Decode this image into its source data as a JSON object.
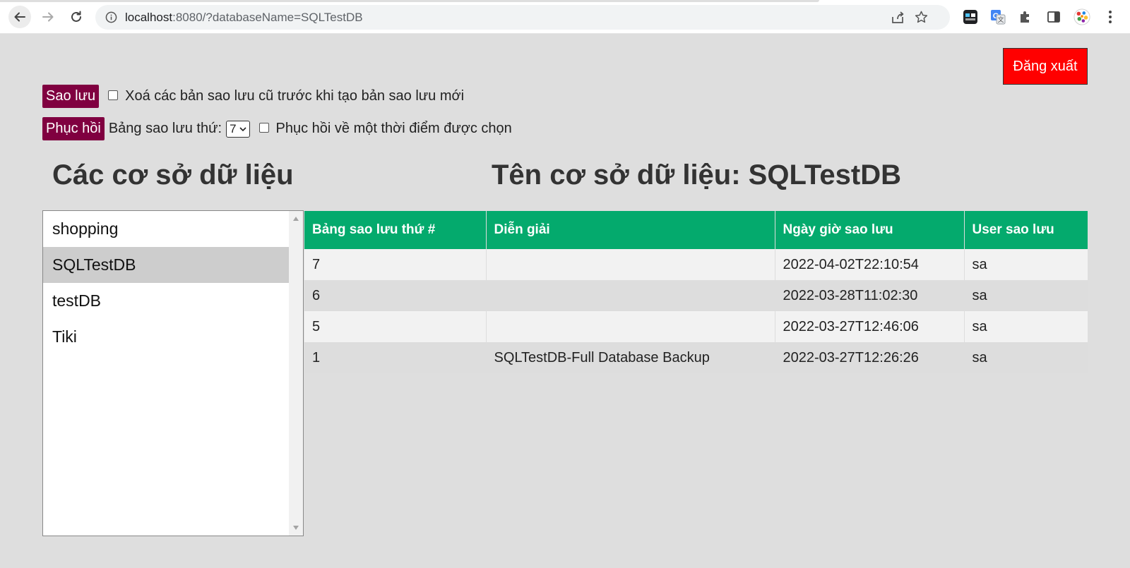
{
  "browser": {
    "url_host": "localhost",
    "url_rest": ":8080/?databaseName=SQLTestDB",
    "icons": [
      "back-icon",
      "forward-icon",
      "reload-icon",
      "info-icon",
      "share-icon",
      "star-icon",
      "extension-icon",
      "translate-icon",
      "puzzle-icon",
      "sidepanel-icon",
      "profile-icon",
      "menu-icon"
    ]
  },
  "header": {
    "logout_label": "Đăng xuất"
  },
  "backup": {
    "button_label": "Sao lưu",
    "checkbox_label": "Xoá các bản sao lưu cũ trước khi tạo bản sao lưu mới",
    "checked": false
  },
  "restore": {
    "button_label": "Phục hồi",
    "select_label": "Bảng sao lưu thứ:",
    "select_value": "7",
    "checkbox_label": "Phục hồi về một thời điểm được chọn",
    "checked": false
  },
  "databases": {
    "title": "Các cơ sở dữ liệu",
    "items": [
      "shopping",
      "SQLTestDB",
      "testDB",
      "Tiki"
    ],
    "selected": "SQLTestDB"
  },
  "detail": {
    "title": "Tên cơ sở dữ liệu: SQLTestDB",
    "columns": [
      "Bảng sao lưu thứ #",
      "Diễn giải",
      "Ngày giờ sao lưu",
      "User sao lưu"
    ],
    "rows": [
      [
        "7",
        "",
        "2022-04-02T22:10:54",
        "sa"
      ],
      [
        "6",
        "",
        "2022-03-28T11:02:30",
        "sa"
      ],
      [
        "5",
        "",
        "2022-03-27T12:46:06",
        "sa"
      ],
      [
        "1",
        "SQLTestDB-Full Database Backup",
        "2022-03-27T12:26:26",
        "sa"
      ]
    ]
  },
  "colors": {
    "header_green": "#04aa6d",
    "button_maroon": "#800040",
    "logout_red": "#ff0000",
    "page_bg": "#dedede"
  }
}
